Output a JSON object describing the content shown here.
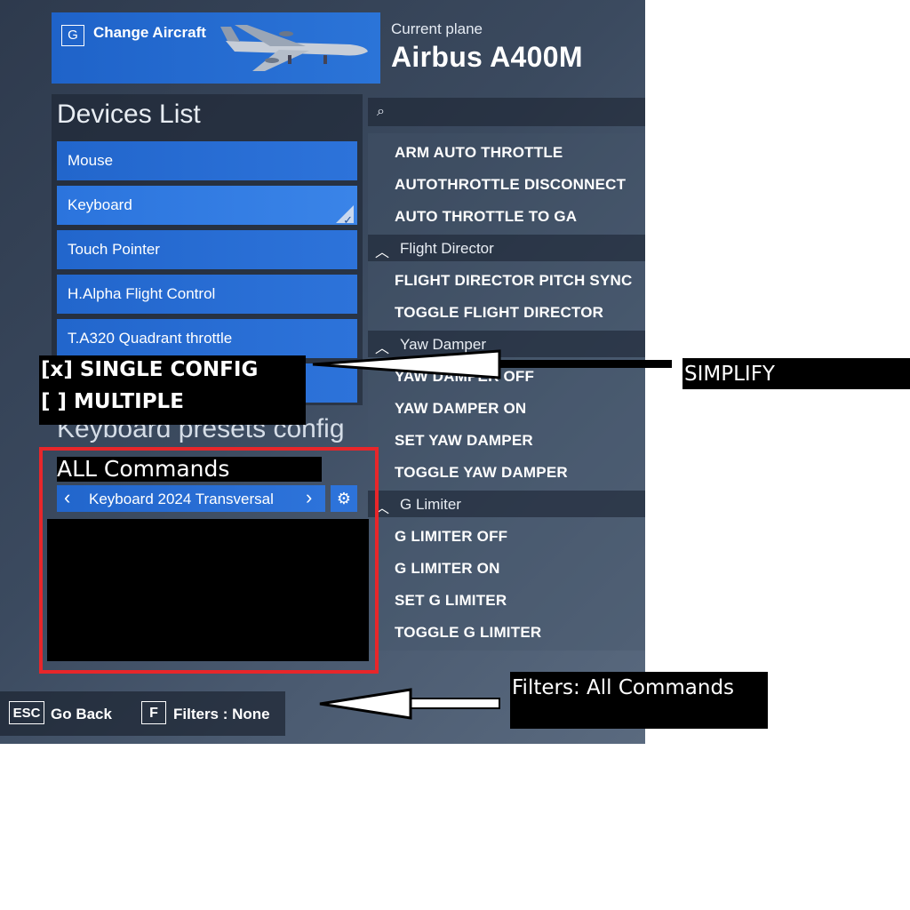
{
  "header": {
    "change_aircraft_key": "G",
    "change_aircraft_label": "Change Aircraft",
    "current_plane_label": "Current plane",
    "current_plane_name": "Airbus A400M"
  },
  "devices": {
    "title": "Devices List",
    "items": [
      {
        "label": "Mouse",
        "selected": false
      },
      {
        "label": "Keyboard",
        "selected": true
      },
      {
        "label": "Touch Pointer",
        "selected": false
      },
      {
        "label": "H.Alpha Flight Control",
        "selected": false
      },
      {
        "label": "T.A320 Quadrant throttle",
        "selected": false
      }
    ]
  },
  "presets": {
    "title": "Keyboard presets config",
    "current_preset": "Keyboard 2024 Transversal"
  },
  "commands": {
    "groups": [
      {
        "items": [
          "ARM AUTO THROTTLE",
          "AUTOTHROTTLE DISCONNECT",
          "AUTO THROTTLE TO GA"
        ]
      },
      {
        "category": "Flight Director",
        "items": [
          "FLIGHT DIRECTOR PITCH SYNC",
          "TOGGLE FLIGHT DIRECTOR"
        ]
      },
      {
        "category": "Yaw Damper",
        "items": [
          "YAW DAMPER OFF",
          "YAW DAMPER ON",
          "SET YAW DAMPER",
          "TOGGLE YAW DAMPER"
        ]
      },
      {
        "category": "G Limiter",
        "items": [
          "G LIMITER OFF",
          "G LIMITER ON",
          "SET G LIMITER",
          "TOGGLE G LIMITER"
        ]
      }
    ]
  },
  "bottom_bar": {
    "back_key": "ESC",
    "back_label": "Go Back",
    "filters_key": "F",
    "filters_label": "Filters : None"
  },
  "annotations": {
    "config_option_single": "[x] SINGLE CONFIG",
    "config_option_multiple": "[ ] MULTIPLE",
    "simplify_label": "SIMPLIFY",
    "all_commands_label": "ALL Commands",
    "filters_note": "Filters: All Commands",
    "arrow_color": "#ffffff",
    "highlight_color": "#e8262a"
  }
}
